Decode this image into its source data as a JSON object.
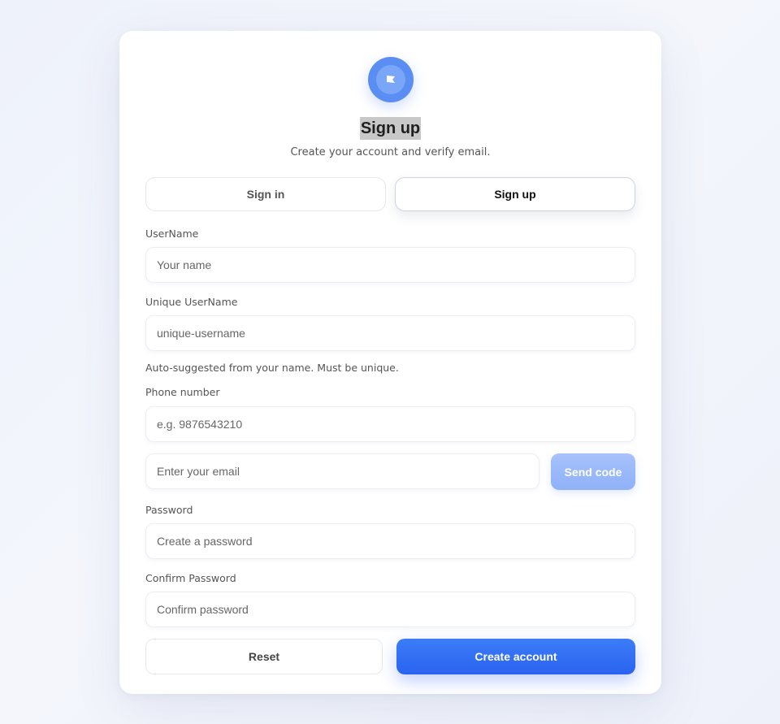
{
  "header": {
    "logo_icon": "flag-icon",
    "title": "Sign up",
    "subtitle": "Create your account and verify email."
  },
  "tabs": [
    {
      "label": "Sign in",
      "active": false
    },
    {
      "label": "Sign up",
      "active": true
    }
  ],
  "form": {
    "username": {
      "label": "UserName",
      "placeholder": "Your name",
      "value": ""
    },
    "unique_username": {
      "label": "Unique UserName",
      "placeholder": "unique-username",
      "value": "",
      "hint": "Auto-suggested from your name. Must be unique."
    },
    "phone": {
      "label": "Phone number",
      "placeholder": "e.g. 9876543210",
      "value": ""
    },
    "email": {
      "placeholder": "Enter your email",
      "value": ""
    },
    "send_code_label": "Send code",
    "password": {
      "label": "Password",
      "placeholder": "Create a password",
      "value": ""
    },
    "confirm_password": {
      "label": "Confirm Password",
      "placeholder": "Confirm password",
      "value": ""
    }
  },
  "actions": {
    "reset_label": "Reset",
    "create_label": "Create account"
  },
  "colors": {
    "accent": "#2f6bf3",
    "accent_disabled": "#9bbaf9",
    "logo_bg": "#5b8ef3"
  }
}
